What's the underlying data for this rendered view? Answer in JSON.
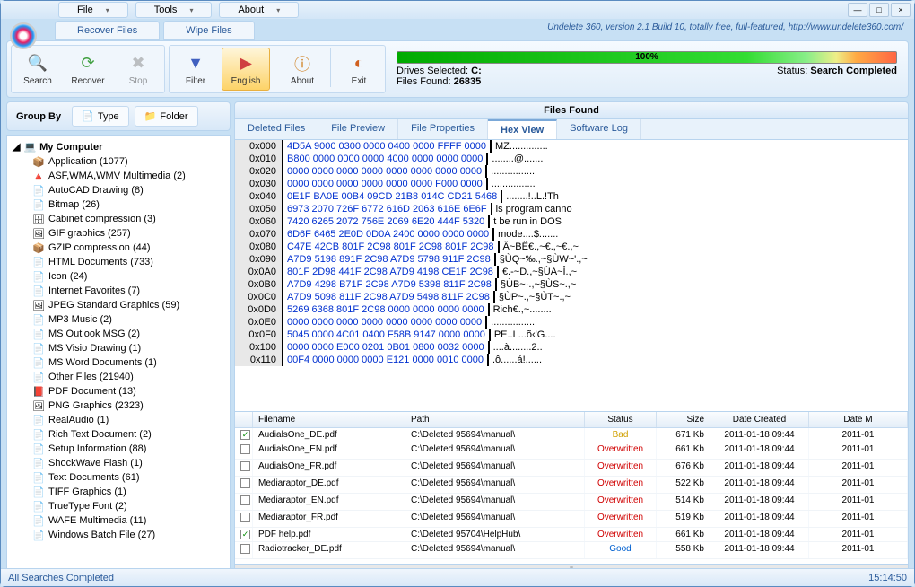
{
  "menu": {
    "file": "File",
    "tools": "Tools",
    "about": "About"
  },
  "mainTabs": {
    "recover": "Recover Files",
    "wipe": "Wipe Files"
  },
  "link": "Undelete 360, version 2.1 Build 10, totally free, full-featured, http://www.undelete360.com/",
  "toolbar": {
    "search": "Search",
    "recover": "Recover",
    "stop": "Stop",
    "filter": "Filter",
    "english": "English",
    "about": "About",
    "exit": "Exit"
  },
  "progress": "100%",
  "status": {
    "drives": "Drives Selected:",
    "drivesVal": "C:",
    "files": "Files Found:",
    "filesVal": "26835",
    "label": "Status:",
    "val": "Search Completed"
  },
  "group": {
    "label": "Group By",
    "type": "Type",
    "folder": "Folder"
  },
  "tree": {
    "root": "My Computer",
    "items": [
      {
        "icon": "📦",
        "label": "Application (1077)"
      },
      {
        "icon": "🔺",
        "label": "ASF,WMA,WMV Multimedia (2)"
      },
      {
        "icon": "📄",
        "label": "AutoCAD Drawing (8)"
      },
      {
        "icon": "📄",
        "label": "Bitmap (26)"
      },
      {
        "icon": "🗄",
        "label": "Cabinet compression (3)"
      },
      {
        "icon": "🖼",
        "label": "GIF graphics (257)"
      },
      {
        "icon": "📦",
        "label": "GZIP compression (44)"
      },
      {
        "icon": "📄",
        "label": "HTML Documents (733)"
      },
      {
        "icon": "📄",
        "label": "Icon (24)"
      },
      {
        "icon": "📄",
        "label": "Internet Favorites (7)"
      },
      {
        "icon": "🖼",
        "label": "JPEG Standard Graphics (59)"
      },
      {
        "icon": "📄",
        "label": "MP3 Music (2)"
      },
      {
        "icon": "📄",
        "label": "MS Outlook MSG (2)"
      },
      {
        "icon": "📄",
        "label": "MS Visio Drawing (1)"
      },
      {
        "icon": "📄",
        "label": "MS Word Documents (1)"
      },
      {
        "icon": "📄",
        "label": "Other Files (21940)"
      },
      {
        "icon": "📕",
        "label": "PDF Document (13)"
      },
      {
        "icon": "🖼",
        "label": "PNG Graphics (2323)"
      },
      {
        "icon": "📄",
        "label": "RealAudio (1)"
      },
      {
        "icon": "📄",
        "label": "Rich Text Document (2)"
      },
      {
        "icon": "📄",
        "label": "Setup Information (88)"
      },
      {
        "icon": "📄",
        "label": "ShockWave Flash (1)"
      },
      {
        "icon": "📄",
        "label": "Text Documents (61)"
      },
      {
        "icon": "📄",
        "label": "TIFF Graphics (1)"
      },
      {
        "icon": "📄",
        "label": "TrueType Font (2)"
      },
      {
        "icon": "📄",
        "label": "WAFE Multimedia (11)"
      },
      {
        "icon": "📄",
        "label": "Windows Batch File (27)"
      }
    ]
  },
  "filesFound": "Files Found",
  "subTabs": {
    "deleted": "Deleted Files",
    "preview": "File Preview",
    "properties": "File Properties",
    "hex": "Hex View",
    "log": "Software Log"
  },
  "hex": [
    {
      "o": "0x000",
      "b": "4D5A 9000 0300 0000 0400 0000 FFFF 0000",
      "a": "MZ.............."
    },
    {
      "o": "0x010",
      "b": "B800 0000 0000 0000 4000 0000 0000 0000",
      "a": "........@......."
    },
    {
      "o": "0x020",
      "b": "0000 0000 0000 0000 0000 0000 0000 0000",
      "a": "................"
    },
    {
      "o": "0x030",
      "b": "0000 0000 0000 0000 0000 0000 F000 0000",
      "a": "................"
    },
    {
      "o": "0x040",
      "b": "0E1F BA0E 00B4 09CD 21B8 014C CD21 5468",
      "a": "........!..L.!Th"
    },
    {
      "o": "0x050",
      "b": "6973 2070 726F 6772 616D 2063 616E 6E6F",
      "a": "is program canno"
    },
    {
      "o": "0x060",
      "b": "7420 6265 2072 756E 2069 6E20 444F 5320",
      "a": "t be run in DOS "
    },
    {
      "o": "0x070",
      "b": "6D6F 6465 2E0D 0D0A 2400 0000 0000 0000",
      "a": "mode....$......."
    },
    {
      "o": "0x080",
      "b": "C47E 42CB 801F 2C98 801F 2C98 801F 2C98",
      "a": "Ä~BË€.,~€.,~€.,~"
    },
    {
      "o": "0x090",
      "b": "A7D9 5198 891F 2C98 A7D9 5798 911F 2C98",
      "a": "§ÙQ~‰.,~§ÙW~'.,~"
    },
    {
      "o": "0x0A0",
      "b": "801F 2D98 441F 2C98 A7D9 4198 CE1F 2C98",
      "a": "€.-~D.,~§ÙA~Î.,~"
    },
    {
      "o": "0x0B0",
      "b": "A7D9 4298 B71F 2C98 A7D9 5398 811F 2C98",
      "a": "§ÙB~·.,~§ÙS~.,~"
    },
    {
      "o": "0x0C0",
      "b": "A7D9 5098 811F 2C98 A7D9 5498 811F 2C98",
      "a": "§ÙP~.,~§ÙT~.,~"
    },
    {
      "o": "0x0D0",
      "b": "5269 6368 801F 2C98 0000 0000 0000 0000",
      "a": "Rich€.,~........"
    },
    {
      "o": "0x0E0",
      "b": "0000 0000 0000 0000 0000 0000 0000 0000",
      "a": "................"
    },
    {
      "o": "0x0F0",
      "b": "5045 0000 4C01 0400 F58B 9147 0000 0000",
      "a": "PE..L...õ‹'G...."
    },
    {
      "o": "0x100",
      "b": "0000 0000 E000 0201 0B01 0800 0032 0000",
      "a": "....à........2.."
    },
    {
      "o": "0x110",
      "b": "00F4 0000 0000 0000 E121 0000 0010 0000",
      "a": ".ô......á!......"
    }
  ],
  "gridHeaders": {
    "filename": "Filename",
    "path": "Path",
    "status": "Status",
    "size": "Size",
    "created": "Date Created",
    "modified": "Date M"
  },
  "files": [
    {
      "chk": true,
      "fn": "AudialsOne_DE.pdf",
      "path": "C:\\Deleted 95694\\manual\\",
      "status": "Bad",
      "statusCls": "status-bad",
      "size": "671 Kb",
      "date": "2011-01-18 09:44",
      "dm": "2011-01"
    },
    {
      "chk": false,
      "fn": "AudialsOne_EN.pdf",
      "path": "C:\\Deleted 95694\\manual\\",
      "status": "Overwritten",
      "statusCls": "status-overwritten",
      "size": "661 Kb",
      "date": "2011-01-18 09:44",
      "dm": "2011-01"
    },
    {
      "chk": false,
      "fn": "AudialsOne_FR.pdf",
      "path": "C:\\Deleted 95694\\manual\\",
      "status": "Overwritten",
      "statusCls": "status-overwritten",
      "size": "676 Kb",
      "date": "2011-01-18 09:44",
      "dm": "2011-01"
    },
    {
      "chk": false,
      "fn": "Mediaraptor_DE.pdf",
      "path": "C:\\Deleted 95694\\manual\\",
      "status": "Overwritten",
      "statusCls": "status-overwritten",
      "size": "522 Kb",
      "date": "2011-01-18 09:44",
      "dm": "2011-01"
    },
    {
      "chk": false,
      "fn": "Mediaraptor_EN.pdf",
      "path": "C:\\Deleted 95694\\manual\\",
      "status": "Overwritten",
      "statusCls": "status-overwritten",
      "size": "514 Kb",
      "date": "2011-01-18 09:44",
      "dm": "2011-01"
    },
    {
      "chk": false,
      "fn": "Mediaraptor_FR.pdf",
      "path": "C:\\Deleted 95694\\manual\\",
      "status": "Overwritten",
      "statusCls": "status-overwritten",
      "size": "519 Kb",
      "date": "2011-01-18 09:44",
      "dm": "2011-01"
    },
    {
      "chk": true,
      "fn": "PDF help.pdf",
      "path": "C:\\Deleted 95704\\HelpHub\\",
      "status": "Overwritten",
      "statusCls": "status-overwritten",
      "size": "661 Kb",
      "date": "2011-01-18 09:44",
      "dm": "2011-01"
    },
    {
      "chk": false,
      "fn": "Radiotracker_DE.pdf",
      "path": "C:\\Deleted 95694\\manual\\",
      "status": "Good",
      "statusCls": "status-good",
      "size": "558 Kb",
      "date": "2011-01-18 09:44",
      "dm": "2011-01"
    }
  ],
  "statusbar": {
    "msg": "All Searches Completed",
    "time": "15:14:50"
  }
}
